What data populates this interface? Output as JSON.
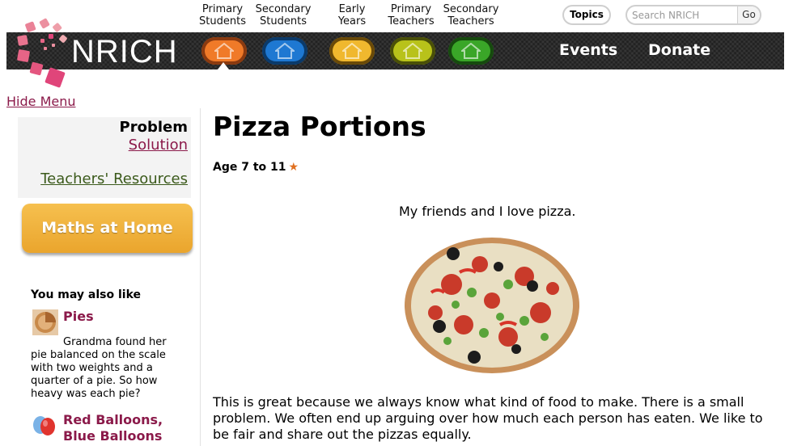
{
  "audience_links": [
    {
      "line1": "Primary",
      "line2": "Students"
    },
    {
      "line1": "Secondary",
      "line2": "Students"
    },
    {
      "line1": "Early",
      "line2": "Years"
    },
    {
      "line1": "Primary",
      "line2": "Teachers"
    },
    {
      "line1": "Secondary",
      "line2": "Teachers"
    }
  ],
  "header": {
    "topics_label": "Topics",
    "search_placeholder": "Search NRICH",
    "go_label": "Go"
  },
  "nav": {
    "logo": "NRICH",
    "pill_colors": [
      "#f07a28",
      "#1e78d2",
      "#f0b82e",
      "#b8c21a",
      "#3aa628"
    ],
    "events_label": "Events",
    "donate_label": "Donate",
    "hide_menu_label": "Hide Menu"
  },
  "sidebar": {
    "problem_label": "Problem",
    "solution_label": "Solution",
    "teachers_label": "Teachers' Resources",
    "maths_home_label": "Maths at Home",
    "also_like_heading": "You may also like",
    "related": [
      {
        "title": "Pies",
        "description": "Grandma found her pie balanced on the scale with two weights and a quarter of a pie. So how heavy was each pie?"
      },
      {
        "title_line1": "Red Balloons,",
        "title_line2": "Blue Balloons"
      }
    ]
  },
  "main": {
    "title": "Pizza Portions",
    "age": "Age 7 to 11",
    "intro": "My friends and I love pizza.",
    "paragraph": "This is great because we always know what kind of food to make. There is a small problem. We often end up arguing over how much each person has eaten. We like to be fair and share out the pizzas equally."
  },
  "colors": {
    "link_maroon": "#8b1a4a",
    "teachers_green": "#3b5a1b",
    "maths_home_orange": "#f0b040",
    "logo_pink": "#e0457a"
  }
}
